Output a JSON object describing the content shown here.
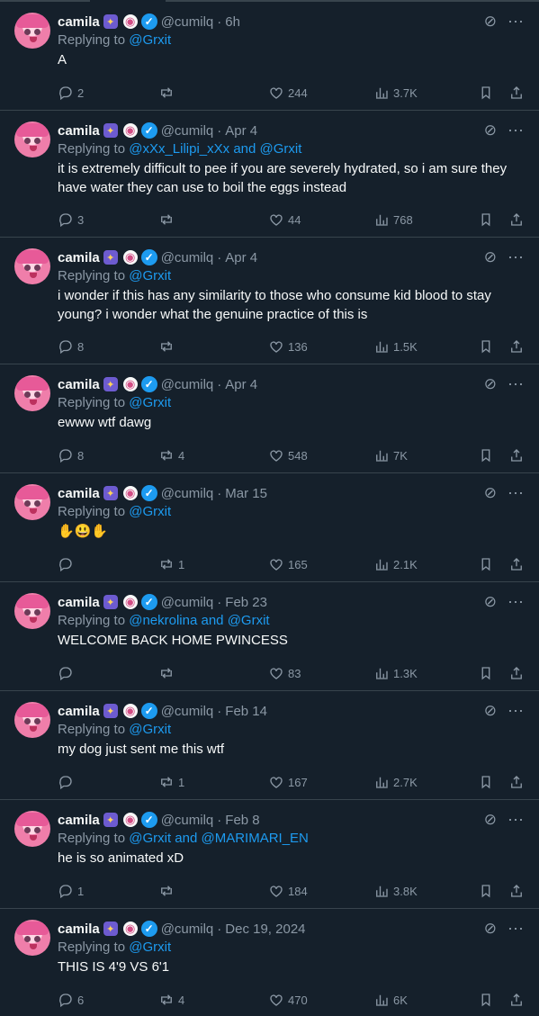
{
  "colors": {
    "background": "#15202b",
    "text": "#f7f9f9",
    "muted": "#8b98a5",
    "mention": "#1d9bf0",
    "border": "#38444d"
  },
  "tweets": [
    {
      "name": "camila",
      "handle": "@cumilq",
      "date": "6h",
      "replying_prefix": "Replying to",
      "mentions": [
        "@Grxit"
      ],
      "joiner": "and",
      "text": "A",
      "replies": "2",
      "retweets": "",
      "likes": "244",
      "views": "3.7K"
    },
    {
      "name": "camila",
      "handle": "@cumilq",
      "date": "Apr 4",
      "replying_prefix": "Replying to",
      "mentions": [
        "@xXx_Lilipi_xXx",
        "@Grxit"
      ],
      "joiner": "and",
      "text": "it is extremely difficult to pee if you are severely hydrated, so i am sure they have water they can use to boil the eggs instead",
      "replies": "3",
      "retweets": "",
      "likes": "44",
      "views": "768"
    },
    {
      "name": "camila",
      "handle": "@cumilq",
      "date": "Apr 4",
      "replying_prefix": "Replying to",
      "mentions": [
        "@Grxit"
      ],
      "joiner": "and",
      "text": "i wonder if this has any similarity to those who consume kid blood to stay young? i wonder what the genuine practice of this is",
      "replies": "8",
      "retweets": "",
      "likes": "136",
      "views": "1.5K"
    },
    {
      "name": "camila",
      "handle": "@cumilq",
      "date": "Apr 4",
      "replying_prefix": "Replying to",
      "mentions": [
        "@Grxit"
      ],
      "joiner": "and",
      "text": "ewww wtf dawg",
      "replies": "8",
      "retweets": "4",
      "likes": "548",
      "views": "7K"
    },
    {
      "name": "camila",
      "handle": "@cumilq",
      "date": "Mar 15",
      "replying_prefix": "Replying to",
      "mentions": [
        "@Grxit"
      ],
      "joiner": "and",
      "text": "✋😃✋",
      "replies": "",
      "retweets": "1",
      "likes": "165",
      "views": "2.1K"
    },
    {
      "name": "camila",
      "handle": "@cumilq",
      "date": "Feb 23",
      "replying_prefix": "Replying to",
      "mentions": [
        "@nekrolina",
        "@Grxit"
      ],
      "joiner": "and",
      "text": "WELCOME BACK HOME PWINCESS",
      "replies": "",
      "retweets": "",
      "likes": "83",
      "views": "1.3K"
    },
    {
      "name": "camila",
      "handle": "@cumilq",
      "date": "Feb 14",
      "replying_prefix": "Replying to",
      "mentions": [
        "@Grxit"
      ],
      "joiner": "and",
      "text": "my dog just sent me this wtf",
      "replies": "",
      "retweets": "1",
      "likes": "167",
      "views": "2.7K"
    },
    {
      "name": "camila",
      "handle": "@cumilq",
      "date": "Feb 8",
      "replying_prefix": "Replying to",
      "mentions": [
        "@Grxit",
        "@MARIMARI_EN"
      ],
      "joiner": "and",
      "text": "he is so animated xD",
      "replies": "1",
      "retweets": "",
      "likes": "184",
      "views": "3.8K"
    },
    {
      "name": "camila",
      "handle": "@cumilq",
      "date": "Dec 19, 2024",
      "replying_prefix": "Replying to",
      "mentions": [
        "@Grxit"
      ],
      "joiner": "and",
      "text": "THIS IS 4'9 VS 6'1",
      "replies": "6",
      "retweets": "4",
      "likes": "470",
      "views": "6K"
    }
  ],
  "icons": [
    "avatar",
    "fairy-emoji-icon",
    "swirl-emoji-icon",
    "verified-badge-icon",
    "grok-icon",
    "more-icon",
    "reply-icon",
    "retweet-icon",
    "like-icon",
    "views-icon",
    "bookmark-icon",
    "share-icon"
  ]
}
